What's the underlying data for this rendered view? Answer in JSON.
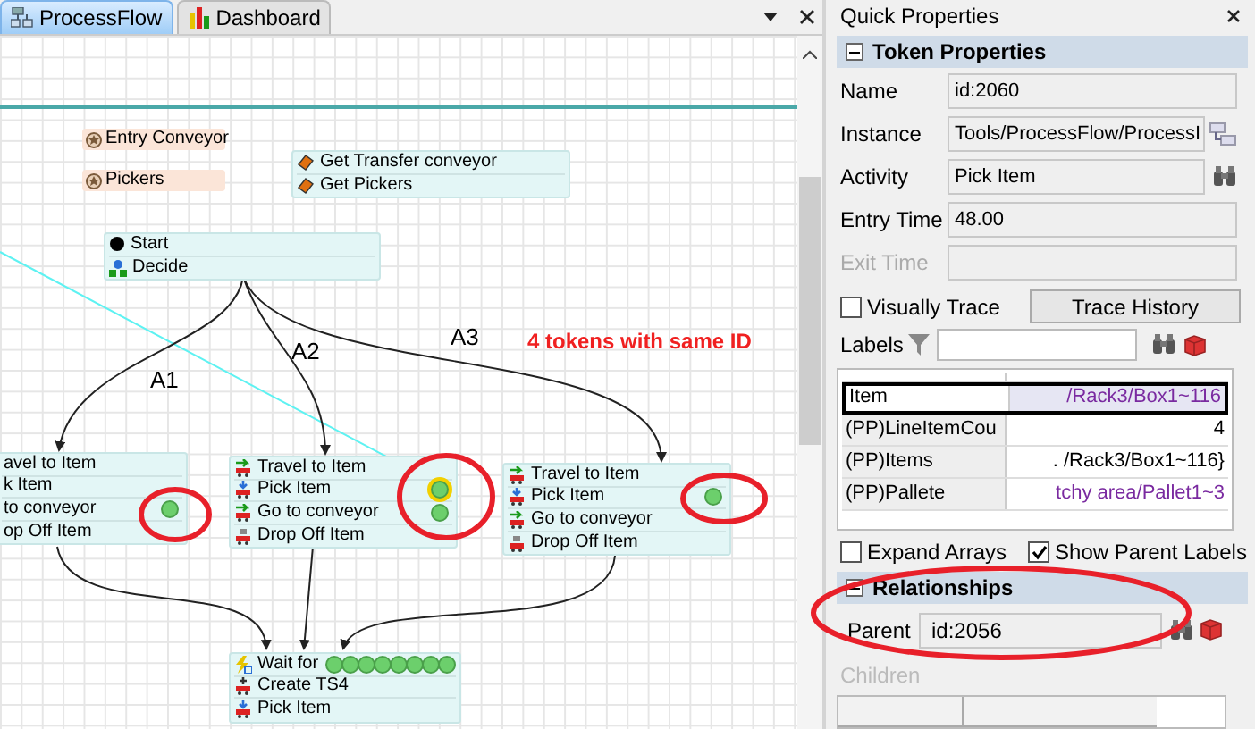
{
  "tabs": [
    {
      "label": "ProcessFlow",
      "selected": true
    },
    {
      "label": "Dashboard",
      "selected": false
    }
  ],
  "canvas": {
    "annotation": "4 tokens with same ID",
    "resources": [
      {
        "label": "Entry Conveyor"
      },
      {
        "label": "Pickers"
      }
    ],
    "nodes": [
      {
        "rows": [
          {
            "kind": "acquire",
            "label": "Get Transfer conveyor",
            "tokens": []
          },
          {
            "kind": "acquire",
            "label": "Get Pickers",
            "tokens": []
          }
        ]
      },
      {
        "rows": [
          {
            "kind": "start",
            "label": "Start",
            "tokens": []
          },
          {
            "kind": "decide",
            "label": "Decide",
            "tokens": []
          }
        ]
      },
      {
        "rows": [
          {
            "kind": "none",
            "label": "avel to Item",
            "tokens": []
          },
          {
            "kind": "none",
            "label": "k Item",
            "tokens": []
          },
          {
            "kind": "none",
            "label": "to conveyor",
            "tokens": [
              {
                "selected": false
              }
            ]
          },
          {
            "kind": "none",
            "label": "op Off Item",
            "tokens": []
          }
        ]
      },
      {
        "rows": [
          {
            "kind": "travel",
            "label": "Travel to Item",
            "tokens": []
          },
          {
            "kind": "pick",
            "label": "Pick Item",
            "tokens": [
              {
                "selected": true
              }
            ]
          },
          {
            "kind": "travel",
            "label": "Go to conveyor",
            "tokens": [
              {
                "selected": false
              }
            ]
          },
          {
            "kind": "drop",
            "label": "Drop Off Item",
            "tokens": []
          }
        ]
      },
      {
        "rows": [
          {
            "kind": "travel",
            "label": "Travel to Item",
            "tokens": []
          },
          {
            "kind": "pick",
            "label": "Pick Item",
            "tokens": [
              {
                "selected": false
              }
            ]
          },
          {
            "kind": "travel",
            "label": "Go to conveyor",
            "tokens": []
          },
          {
            "kind": "drop",
            "label": "Drop Off Item",
            "tokens": []
          }
        ]
      },
      {
        "rows": [
          {
            "kind": "wait",
            "label": "Wait for",
            "tokens": [
              {
                "selected": false
              },
              {
                "selected": false
              },
              {
                "selected": false
              },
              {
                "selected": false
              },
              {
                "selected": false
              },
              {
                "selected": false
              },
              {
                "selected": false
              },
              {
                "selected": false
              }
            ]
          },
          {
            "kind": "create",
            "label": "Create TS4",
            "tokens": []
          },
          {
            "kind": "pick",
            "label": "Pick Item",
            "tokens": []
          }
        ]
      }
    ],
    "branches": [
      {
        "label": "A1"
      },
      {
        "label": "A2"
      },
      {
        "label": "A3"
      }
    ]
  },
  "panel": {
    "title": "Quick Properties",
    "token_section": {
      "title": "Token Properties",
      "expanded": true
    },
    "fields": [
      {
        "label": "Name",
        "value": "id:2060",
        "disabled": false
      },
      {
        "label": "Instance",
        "value": "Tools/ProcessFlow/ProcessI",
        "disabled": false
      },
      {
        "label": "Activity",
        "value": "Pick Item",
        "disabled": false
      },
      {
        "label": "Entry Time",
        "value": "48.00",
        "disabled": false
      },
      {
        "label": "Exit Time",
        "disabled": true
      }
    ],
    "visually_trace": {
      "label": "Visually Trace",
      "checked": false
    },
    "trace_button": "Trace History",
    "labels_label": "Labels",
    "labels": [
      {
        "name": "Item",
        "value": "/Rack3/Box1~116",
        "kind": "string",
        "selected": true
      },
      {
        "name": "(PP)LineItemCou",
        "value": "4",
        "kind": "number",
        "selected": false
      },
      {
        "name": "(PP)Items",
        "value": ". /Rack3/Box1~116}",
        "kind": "number",
        "selected": false
      },
      {
        "name": "(PP)Pallete",
        "value": "tchy area/Pallet1~3",
        "kind": "string",
        "selected": false
      }
    ],
    "expand_arrays": {
      "label": "Expand Arrays",
      "checked": false
    },
    "show_parent_labels": {
      "label": "Show Parent Labels",
      "checked": true
    },
    "relationships_section": {
      "title": "Relationships",
      "expanded": true
    },
    "parent": {
      "label": "Parent",
      "value": "id:2056"
    },
    "children_label": "Children"
  }
}
